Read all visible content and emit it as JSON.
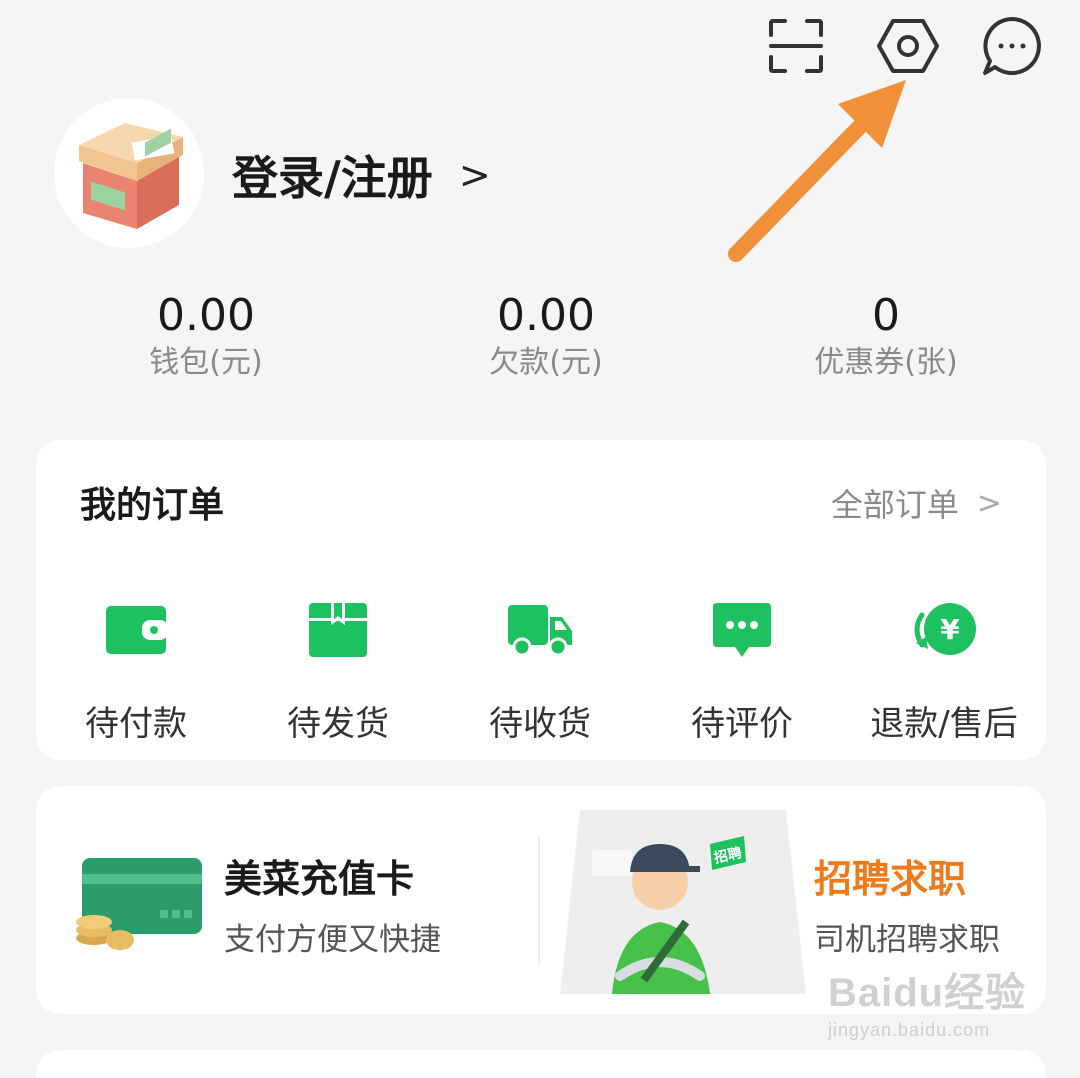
{
  "header": {
    "icons": [
      "scan-icon",
      "settings-icon",
      "message-icon"
    ],
    "annotation_color": "#f0913a"
  },
  "profile": {
    "login_label": "登录/注册",
    "chevron": ">"
  },
  "stats": [
    {
      "value": "0.00",
      "label": "钱包(元)"
    },
    {
      "value": "0.00",
      "label": "欠款(元)"
    },
    {
      "value": "0",
      "label": "优惠券(张)"
    }
  ],
  "orders": {
    "title": "我的订单",
    "all_label": "全部订单",
    "chevron": ">",
    "accent": "#1ec15f",
    "items": [
      {
        "label": "待付款",
        "icon": "wallet-icon"
      },
      {
        "label": "待发货",
        "icon": "package-icon"
      },
      {
        "label": "待收货",
        "icon": "truck-icon"
      },
      {
        "label": "待评价",
        "icon": "comment-icon"
      },
      {
        "label": "退款/售后",
        "icon": "refund-icon"
      }
    ]
  },
  "services": {
    "recharge": {
      "title": "美菜充值卡",
      "subtitle": "支付方便又快捷"
    },
    "jobs": {
      "title": "招聘求职",
      "subtitle": "司机招聘求职",
      "badge": "招聘",
      "title_color": "#ef7a1a"
    }
  },
  "watermark": {
    "brand": "Baidu经验",
    "url": "jingyan.baidu.com"
  }
}
